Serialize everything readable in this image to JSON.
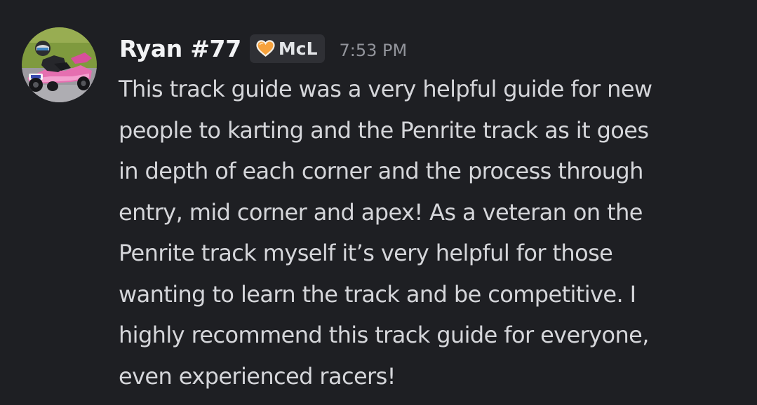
{
  "message": {
    "author": "Ryan #77",
    "tag": {
      "label": "McL",
      "icon": "orange-heart-icon",
      "icon_color": "#f7a23c"
    },
    "timestamp": "7:53 PM",
    "avatar": "avatar-go-kart-driver",
    "content_lines": [
      "This track guide was a very helpful guide for new",
      "people to karting and the Penrite track as it goes",
      "in depth of each corner and the process through",
      "entry, mid corner and apex! As a veteran on the",
      "Penrite track myself it’s very helpful for those",
      "wanting to learn the track and be competitive. I",
      "highly recommend this track guide for everyone,",
      "even experienced racers!"
    ]
  },
  "colors": {
    "background": "#1e1f23",
    "username": "#f2f3f5",
    "message_text": "#d5d6da",
    "timestamp": "#92949b",
    "tag_background": "#2f3035"
  }
}
